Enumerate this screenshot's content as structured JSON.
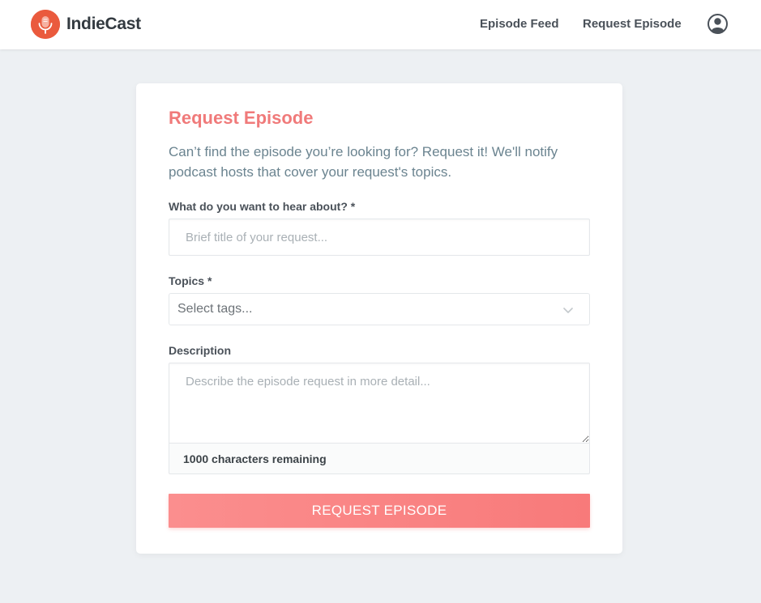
{
  "header": {
    "brand": "IndieCast",
    "nav": [
      {
        "label": "Episode Feed"
      },
      {
        "label": "Request Episode"
      }
    ]
  },
  "form": {
    "title": "Request Episode",
    "intro": "Can’t find the episode you’re looking for? Request it! We'll notify podcast hosts that cover your request's topics.",
    "title_field": {
      "label": "What do you want to hear about? *",
      "placeholder": "Brief title of your request...",
      "value": ""
    },
    "topics_field": {
      "label": "Topics *",
      "selected": "Select tags..."
    },
    "description_field": {
      "label": "Description",
      "placeholder": "Describe the episode request in more detail...",
      "value": "",
      "counter": "1000 characters remaining"
    },
    "submit_label": "REQUEST EPISODE"
  },
  "colors": {
    "brand": "#ea5a3d",
    "accent": "#f87a7a",
    "background": "#edf0f3"
  },
  "icons": {
    "logo": "microphone-icon",
    "profile": "user-icon",
    "dropdown": "chevron-down-icon"
  }
}
